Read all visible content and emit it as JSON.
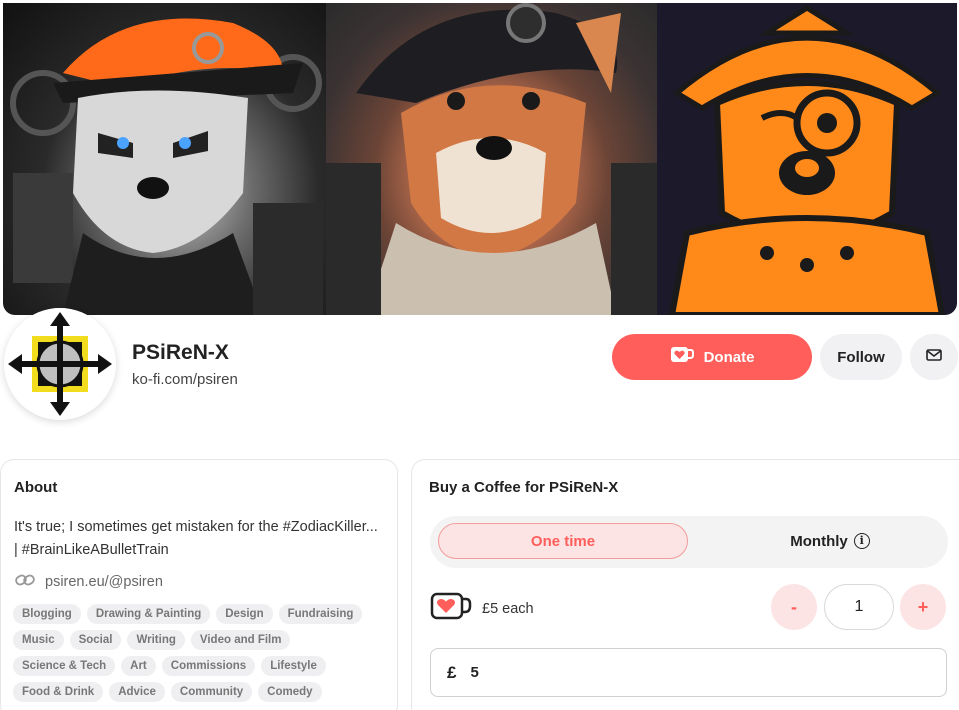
{
  "profile": {
    "name": "PSiReN-X",
    "url": "ko-fi.com/psiren"
  },
  "actions": {
    "donate_label": "Donate",
    "follow_label": "Follow",
    "message_icon": "mail-icon"
  },
  "about": {
    "title": "About",
    "bio": "It's true; I sometimes get mistaken for the #ZodiacKiller... | #BrainLikeABulletTrain",
    "link": "psiren.eu/@psiren",
    "tags": [
      "Blogging",
      "Drawing & Painting",
      "Design",
      "Fundraising",
      "Music",
      "Social",
      "Writing",
      "Video and Film",
      "Science & Tech",
      "Art",
      "Commissions",
      "Lifestyle",
      "Food & Drink",
      "Advice",
      "Community",
      "Comedy"
    ]
  },
  "coffee": {
    "title": "Buy a Coffee for PSiReN-X",
    "one_time_label": "One time",
    "monthly_label": "Monthly",
    "price_label": "£5 each",
    "minus_label": "-",
    "quantity": "1",
    "plus_label": "+",
    "currency_symbol": "£",
    "amount": "5"
  },
  "colors": {
    "brand": "#ff5e5b",
    "brand_light": "#fde4e4",
    "chip_bg": "#efeff1"
  }
}
